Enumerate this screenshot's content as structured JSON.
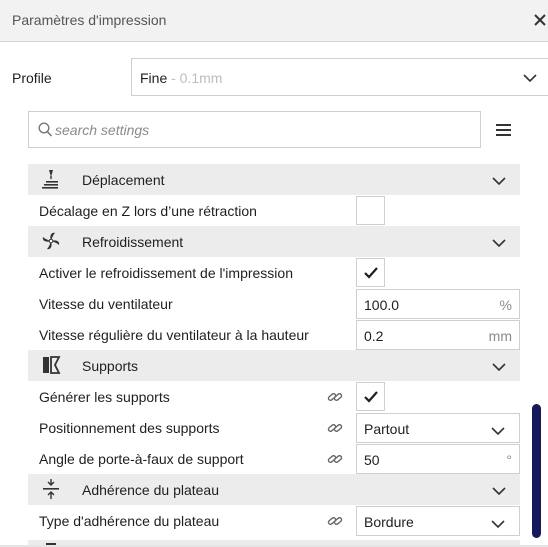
{
  "window": {
    "title": "Paramètres d'impression"
  },
  "profile": {
    "label": "Profile",
    "name": "Fine",
    "detail": " - 0.1mm"
  },
  "search": {
    "placeholder": "search settings"
  },
  "sections": {
    "deplacement": {
      "label": "Déplacement",
      "settings": {
        "z_hop": {
          "label": "Décalage en Z lors d’une rétraction",
          "checked": false
        }
      }
    },
    "refroidissement": {
      "label": "Refroidissement",
      "settings": {
        "enable_cooling": {
          "label": "Activer le refroidissement de l'impression",
          "checked": true
        },
        "fan_speed": {
          "label": "Vitesse du ventilateur",
          "value": "100.0",
          "unit": "%"
        },
        "regular_fan_height": {
          "label": "Vitesse régulière du ventilateur à la hauteur",
          "value": "0.2",
          "unit": "mm"
        }
      }
    },
    "supports": {
      "label": "Supports",
      "settings": {
        "generate_support": {
          "label": "Générer les supports",
          "checked": true
        },
        "support_placement": {
          "label": "Positionnement des supports",
          "value": "Partout"
        },
        "support_angle": {
          "label": "Angle de porte-à-faux de support",
          "value": "50",
          "unit": "°"
        }
      }
    },
    "adhesion": {
      "label": "Adhérence du plateau",
      "settings": {
        "adhesion_type": {
          "label": "Type d'adhérence du plateau",
          "value": "Bordure"
        }
      }
    }
  },
  "colors": {
    "scrollbar": "#15195c",
    "category_bg": "#ececec",
    "border": "#cfcfcf"
  }
}
